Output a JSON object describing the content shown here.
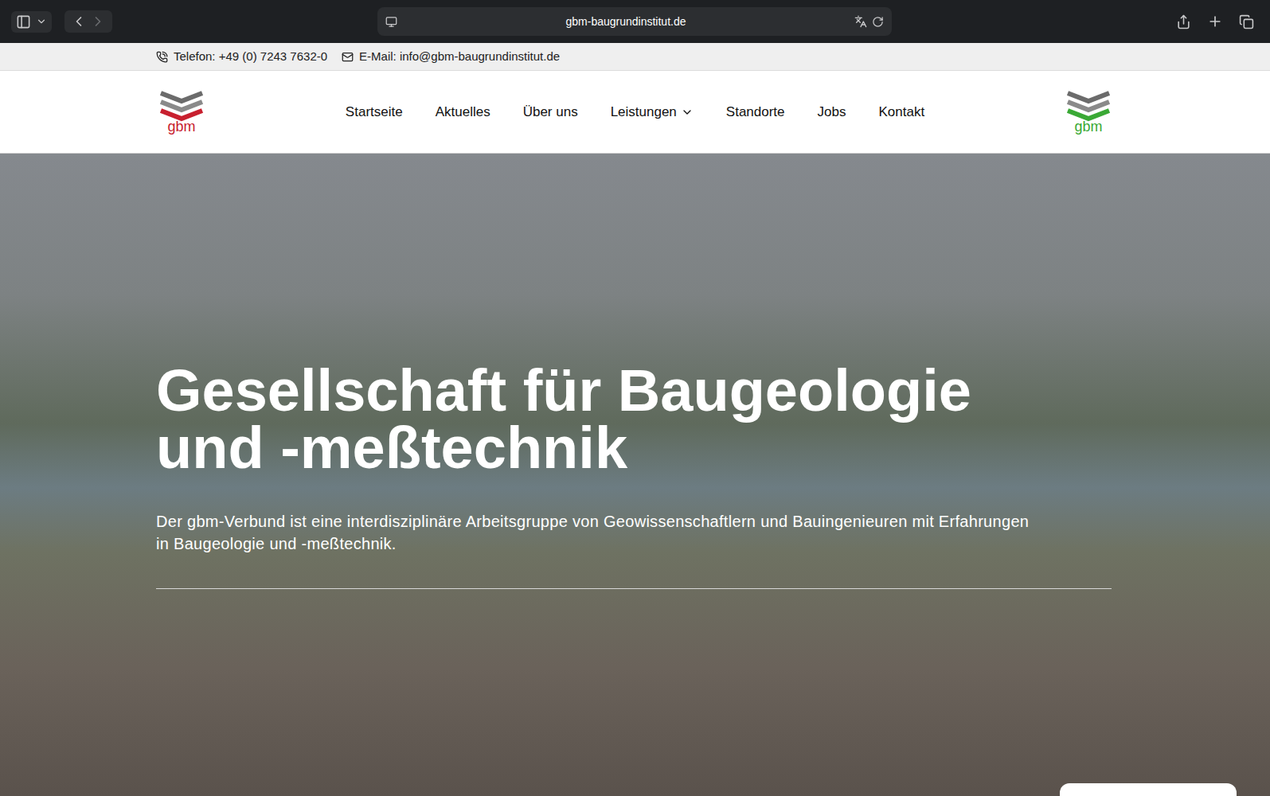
{
  "browser": {
    "url": "gbm-baugrundinstitut.de"
  },
  "topbar": {
    "phone": "Telefon: +49 (0) 7243 7632-0",
    "email": "E-Mail: info@gbm-baugrundinstitut.de"
  },
  "logos": [
    {
      "text": "gbm",
      "color": "#c8202f"
    },
    {
      "text": "gbm",
      "color": "#3aa935"
    }
  ],
  "nav": [
    {
      "label": "Startseite",
      "dropdown": false
    },
    {
      "label": "Aktuelles",
      "dropdown": false
    },
    {
      "label": "Über uns",
      "dropdown": false
    },
    {
      "label": "Leistungen",
      "dropdown": true
    },
    {
      "label": "Standorte",
      "dropdown": false
    },
    {
      "label": "Jobs",
      "dropdown": false
    },
    {
      "label": "Kontakt",
      "dropdown": false
    }
  ],
  "hero": {
    "title_lines": [
      "Gesellschaft für Baugeologie",
      "und -meßtechnik"
    ],
    "subtitle": "Der gbm-Verbund ist eine interdisziplinäre Arbeitsgruppe von Geowissenschaftlern und Bauingenieuren mit Erfahrungen in Baugeologie und -meßtechnik."
  }
}
